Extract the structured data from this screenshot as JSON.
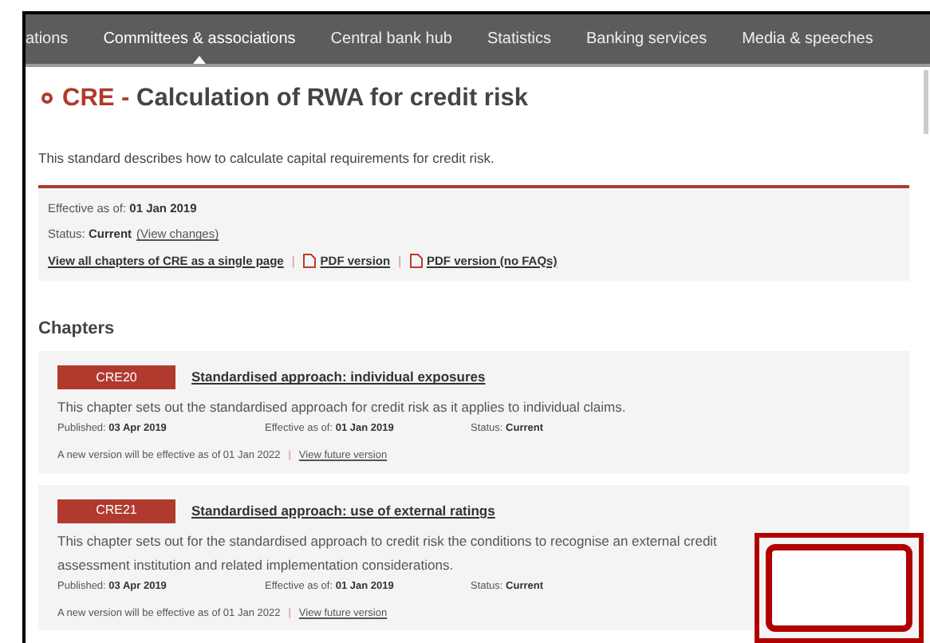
{
  "nav": [
    {
      "label": "ations",
      "selected": false
    },
    {
      "label": "Committees & associations",
      "selected": true
    },
    {
      "label": "Central bank hub",
      "selected": false
    },
    {
      "label": "Statistics",
      "selected": false
    },
    {
      "label": "Banking services",
      "selected": false
    },
    {
      "label": "Media & speeches",
      "selected": false
    }
  ],
  "standard": {
    "code": "CRE",
    "separator": "-",
    "title": "Calculation of RWA for credit risk",
    "description": "This standard describes how to calculate capital requirements for credit risk."
  },
  "info": {
    "effective_label": "Effective as of:",
    "effective": "01 Jan 2019",
    "status_label": "Status:",
    "status": "Current",
    "changes_link": "(View changes)",
    "links": [
      {
        "label": "View all chapters of CRE as a single page",
        "pdf": false
      },
      {
        "label": "PDF version",
        "pdf": true
      },
      {
        "label": "PDF version (no FAQs)",
        "pdf": true
      }
    ],
    "link_separator": "|"
  },
  "chapters_heading": "Chapters",
  "chapters": [
    {
      "code": "CRE20",
      "title": "Standardised approach: individual exposures",
      "description": "This chapter sets out the standardised approach for credit risk as it applies to individual claims.",
      "published_label": "Published:",
      "published": "03 Apr 2019",
      "effective_label": "Effective as of:",
      "effective": "01 Jan 2019",
      "status_label": "Status:",
      "status": "Current",
      "future_note": "A new version will be effective as of 01 Jan 2022",
      "future_link": "View future version"
    },
    {
      "code": "CRE21",
      "title": "Standardised approach: use of external ratings",
      "description": "This chapter sets out for the standardised approach to credit risk the conditions to recognise an external credit assessment institution and related implementation considerations.",
      "published_label": "Published:",
      "published": "03 Apr 2019",
      "effective_label": "Effective as of:",
      "effective": "01 Jan 2019",
      "status_label": "Status:",
      "status": "Current",
      "future_note": "A new version will be effective as of 01 Jan 2022",
      "future_link": "View future version"
    }
  ]
}
